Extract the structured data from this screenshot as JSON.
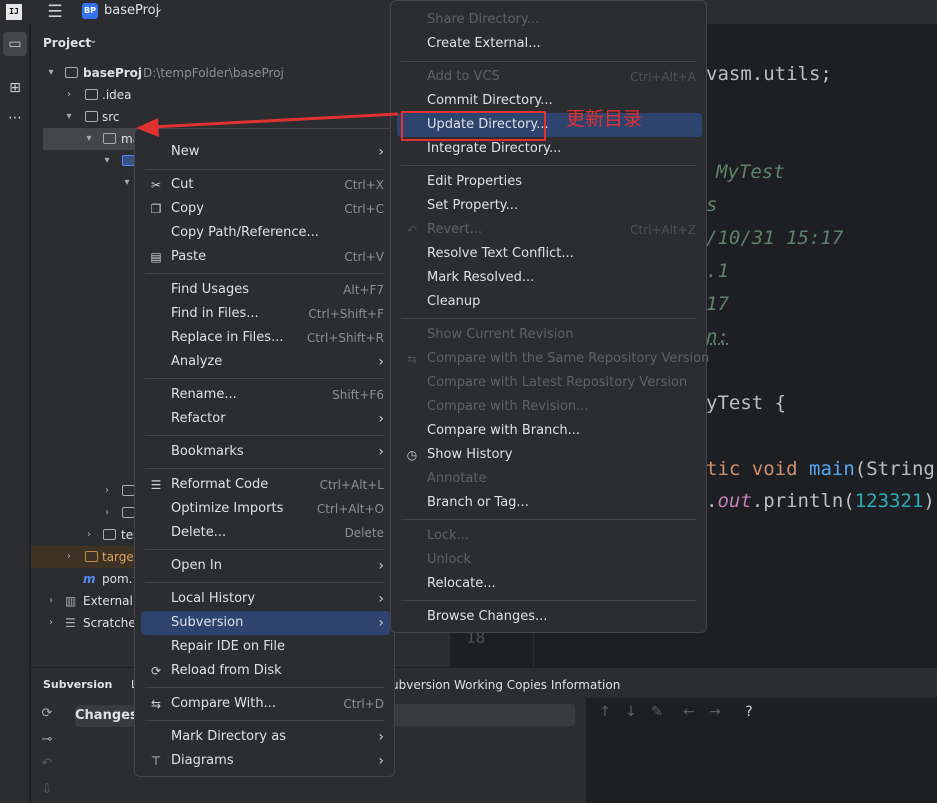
{
  "titlebar": {
    "logo_text": "IJ",
    "project_badge": "BP",
    "project_name": "baseProj"
  },
  "project_panel": {
    "header": "Project",
    "tree": {
      "root": {
        "name": "baseProj",
        "path": "D:\\tempFolder\\baseProj"
      },
      "idea": ".idea",
      "src": "src",
      "main": "ma",
      "test": "tes",
      "target": "target",
      "pom": "pom.:",
      "external": "External",
      "scratches": "Scratches"
    }
  },
  "editor": {
    "line_asm": "vasm.utils;",
    "line_mytest": "MyTest",
    "line_s": "s",
    "line_date": "/10/31 15:17",
    "line_1": ".1",
    "line_17": "17",
    "line_n": "n:",
    "line_class": "yTest {",
    "line_main_kw1": "tic",
    "line_main_kw2": "void",
    "line_main_fn": "main",
    "line_main_rest": "(String",
    "line_print_dot": ".",
    "line_print_out": "out",
    "line_print_call": ".println(",
    "line_print_num": "123321",
    "line_print_end": ")",
    "line_number_18": "18"
  },
  "bottom_panel": {
    "title": "Subversion",
    "tab_partial": "L",
    "info": "ubversion Working Copies Information",
    "changes_tab": "Changes",
    "help_icon": "?"
  },
  "context_menu": {
    "items": [
      {
        "label": "New",
        "submenu": true
      },
      {
        "label": "Cut",
        "shortcut": "Ctrl+X",
        "icon": "scissors-icon"
      },
      {
        "label": "Copy",
        "shortcut": "Ctrl+C",
        "icon": "copy-icon"
      },
      {
        "label": "Copy Path/Reference..."
      },
      {
        "label": "Paste",
        "shortcut": "Ctrl+V",
        "icon": "paste-icon"
      },
      {
        "label": "Find Usages",
        "shortcut": "Alt+F7"
      },
      {
        "label": "Find in Files...",
        "shortcut": "Ctrl+Shift+F"
      },
      {
        "label": "Replace in Files...",
        "shortcut": "Ctrl+Shift+R"
      },
      {
        "label": "Analyze",
        "submenu": true
      },
      {
        "label": "Rename...",
        "shortcut": "Shift+F6"
      },
      {
        "label": "Refactor",
        "submenu": true
      },
      {
        "label": "Bookmarks",
        "submenu": true
      },
      {
        "label": "Reformat Code",
        "shortcut": "Ctrl+Alt+L",
        "icon": "reformat-icon"
      },
      {
        "label": "Optimize Imports",
        "shortcut": "Ctrl+Alt+O"
      },
      {
        "label": "Delete...",
        "shortcut": "Delete"
      },
      {
        "label": "Open In",
        "submenu": true
      },
      {
        "label": "Local History",
        "submenu": true
      },
      {
        "label": "Subversion",
        "submenu": true,
        "highlighted": true
      },
      {
        "label": "Repair IDE on File"
      },
      {
        "label": "Reload from Disk",
        "icon": "reload-icon"
      },
      {
        "label": "Compare With...",
        "shortcut": "Ctrl+D",
        "icon": "compare-icon"
      },
      {
        "label": "Mark Directory as",
        "submenu": true
      },
      {
        "label": "Diagrams",
        "submenu": true,
        "icon": "diagram-icon"
      }
    ]
  },
  "subversion_menu": {
    "items": [
      {
        "label": "Share Directory...",
        "disabled": true
      },
      {
        "label": "Create External..."
      },
      {
        "label": "Add to VCS",
        "shortcut": "Ctrl+Alt+A",
        "disabled": true
      },
      {
        "label": "Commit Directory..."
      },
      {
        "label": "Update Directory...",
        "highlighted": true
      },
      {
        "label": "Integrate Directory..."
      },
      {
        "label": "Edit Properties"
      },
      {
        "label": "Set Property..."
      },
      {
        "label": "Revert...",
        "shortcut": "Ctrl+Alt+Z",
        "disabled": true,
        "icon": "revert-icon"
      },
      {
        "label": "Resolve Text Conflict..."
      },
      {
        "label": "Mark Resolved..."
      },
      {
        "label": "Cleanup"
      },
      {
        "label": "Show Current Revision",
        "disabled": true
      },
      {
        "label": "Compare with the Same Repository Version",
        "disabled": true,
        "icon": "compare-icon"
      },
      {
        "label": "Compare with Latest Repository Version",
        "disabled": true
      },
      {
        "label": "Compare with Revision...",
        "disabled": true
      },
      {
        "label": "Compare with Branch..."
      },
      {
        "label": "Show History",
        "icon": "clock-icon"
      },
      {
        "label": "Annotate",
        "disabled": true
      },
      {
        "label": "Branch or Tag..."
      },
      {
        "label": "Lock...",
        "disabled": true
      },
      {
        "label": "Unlock",
        "disabled": true
      },
      {
        "label": "Relocate..."
      },
      {
        "label": "Browse Changes..."
      }
    ]
  },
  "annotation": {
    "label": "更新目录",
    "color": "#e03131"
  },
  "colors": {
    "accent": "#3574f0",
    "selection": "#2e436e",
    "annotation": "#e03131"
  }
}
